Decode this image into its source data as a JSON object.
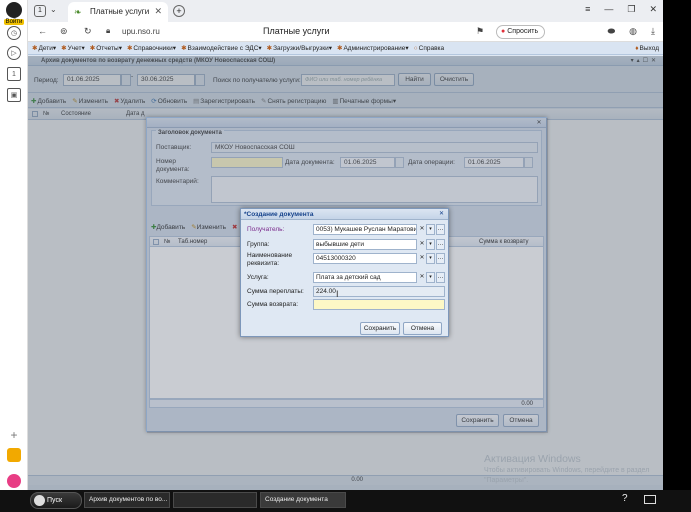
{
  "browser": {
    "tab_count": "1",
    "tab_title": "Платные услуги",
    "url": "upu.nso.ru",
    "page_title": "Платные услуги",
    "ask_label": "Спросить",
    "login_label": "Войти"
  },
  "menu": {
    "items": [
      "Дети",
      "Учет",
      "Отчеты",
      "Справочники",
      "Взаимодействие с ЭДС",
      "Загрузки/Выгрузки",
      "Администрирование",
      "Справка"
    ],
    "exit": "Выход"
  },
  "panel": {
    "title": "Архив документов по возврату денежных средств (МКОУ Новоcпасская СОШ)"
  },
  "filter": {
    "period_label": "Период:",
    "date_from": "01.06.2025",
    "date_to": "30.06.2025",
    "recipient_label": "Поиск по получателю услуги:",
    "recipient_placeholder": "ФИО или таб. номер ребёнка",
    "find_button": "Найти",
    "clear_button": "Очистить"
  },
  "toolbar": {
    "add": "Добавить",
    "edit": "Изменить",
    "delete": "Удалить",
    "refresh": "Обновить",
    "register": "Зарегистрировать",
    "unregister": "Снять регистрацию",
    "print": "Печатные формы"
  },
  "grid": {
    "col_num": "№",
    "col_state": "Состояние",
    "col_date": "Дата д",
    "total": "0.00"
  },
  "doc_header": {
    "legend": "Заголовок документа",
    "supplier_label": "Поставщик:",
    "supplier_value": "МКОУ Новоспасская СОШ",
    "doc_number_label": "Номер документа:",
    "doc_date_label": "Дата документа:",
    "doc_date_value": "01.06.2025",
    "op_date_label": "Дата операции:",
    "op_date_value": "01.06.2025",
    "comment_label": "Комментарий:",
    "toolbar_add": "Добавить",
    "toolbar_edit": "Изменить",
    "col_num": "№",
    "col_tab": "Таб.номер",
    "col_return_sum": "Сумма к возврату",
    "total": "0.00",
    "save_button": "Сохранить",
    "cancel_button": "Отмена"
  },
  "create_doc": {
    "title": "*Создание документа",
    "recipient_label": "Получатель:",
    "recipient_value": "0053) Мукашев Руслан Маратович",
    "group_label": "Группа:",
    "group_value": "выбывшие дети",
    "requisite_label": "Наименование реквизита:",
    "requisite_value": "04513000320",
    "service_label": "Услуга:",
    "service_value": "Плата за детский сад",
    "overpay_label": "Сумма переплаты:",
    "overpay_value": "224.00",
    "return_label": "Сумма возврата:",
    "return_value": "",
    "save_button": "Сохранить",
    "cancel_button": "Отмена"
  },
  "watermark": {
    "title": "Активация Windows",
    "text": "Чтобы активировать Windows, перейдите в раздел \"Параметры\"."
  },
  "taskbar": {
    "start": "Пуск",
    "task1": "Архив документов по во...",
    "task2": "",
    "task3": "Создание документа"
  }
}
